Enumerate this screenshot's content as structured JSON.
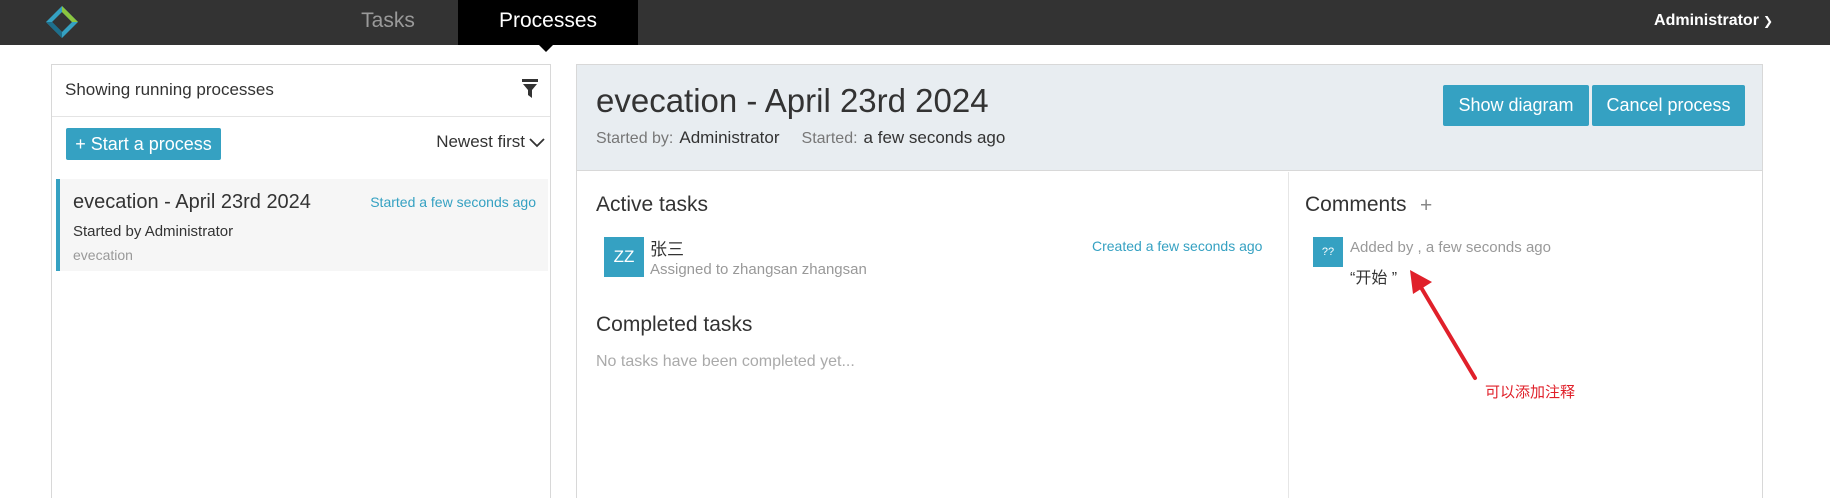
{
  "nav": {
    "logo_icon": "diamond-logo-icon",
    "tabs": [
      {
        "label": "Tasks",
        "active": false
      },
      {
        "label": "Processes",
        "active": true
      }
    ],
    "user": "Administrator"
  },
  "left_panel": {
    "header": "Showing running processes",
    "start_button": "+ Start a process",
    "sort_label": "Newest first",
    "process": {
      "name": "evecation - April 23rd 2024",
      "started": "Started a few seconds ago",
      "started_by": "Started by Administrator",
      "key": "evecation"
    }
  },
  "detail": {
    "title": "evecation - April 23rd 2024",
    "started_by_label": "Started by:",
    "started_by_value": "Administrator",
    "started_label": "Started:",
    "started_value": "a few seconds ago",
    "show_diagram": "Show diagram",
    "cancel_process": "Cancel process",
    "active_tasks": {
      "title": "Active tasks",
      "items": [
        {
          "initials": "ZZ",
          "name": "张三",
          "assignee": "Assigned to zhangsan zhangsan",
          "created": "Created a few seconds ago"
        }
      ]
    },
    "completed_tasks": {
      "title": "Completed tasks",
      "empty": "No tasks have been completed yet..."
    },
    "comments": {
      "title": "Comments",
      "add": "+",
      "items": [
        {
          "avatar": "??",
          "meta": "Added by , a few seconds ago",
          "text": "“开始 ”"
        }
      ]
    }
  },
  "annotation": {
    "text": "可以添加注释",
    "color": "#e0202a"
  },
  "colors": {
    "accent": "#35a1c2",
    "topbar": "#333333",
    "header_bg": "#e8edf1"
  }
}
